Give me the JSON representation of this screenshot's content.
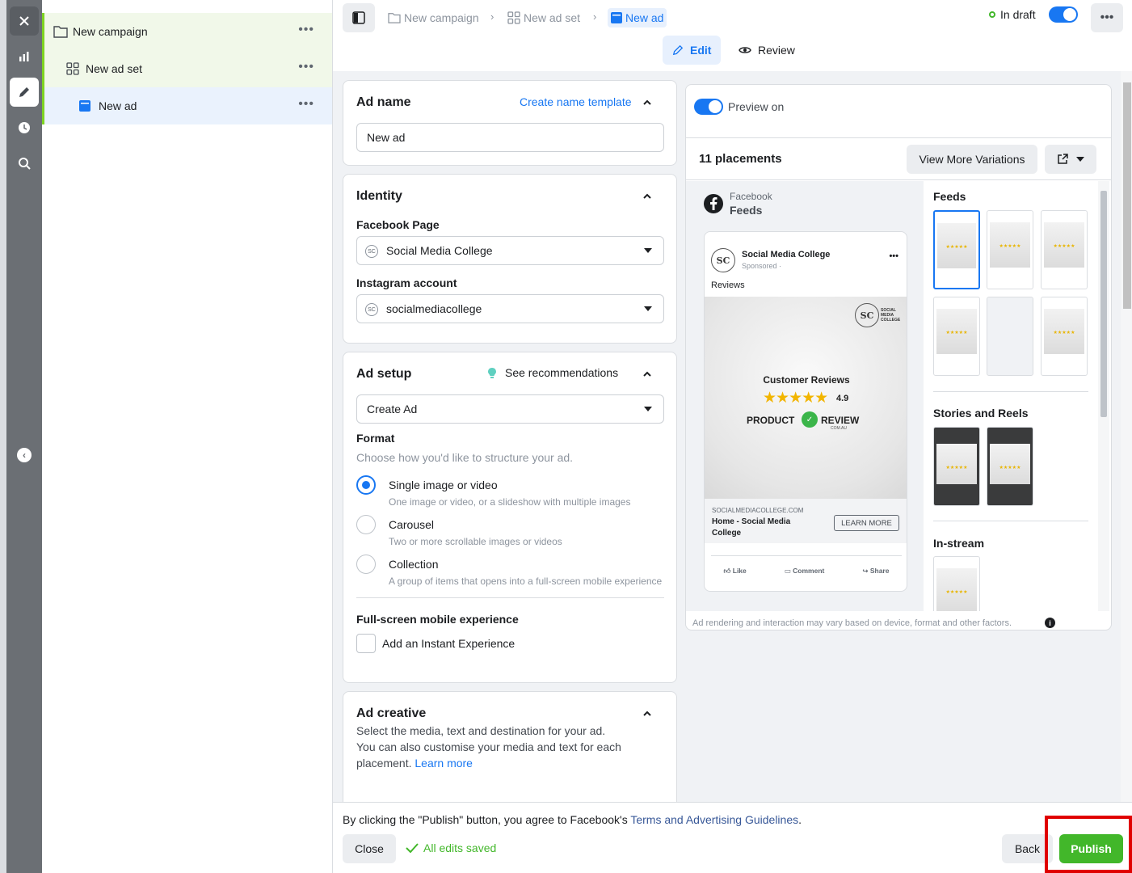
{
  "tree": {
    "campaign": {
      "label": "New campaign"
    },
    "adset": {
      "label": "New ad set"
    },
    "ad": {
      "label": "New ad"
    },
    "more_glyph": "•••"
  },
  "topbar": {
    "breadcrumbs": [
      "New campaign",
      "New ad set",
      "New ad"
    ],
    "status": "In draft",
    "tabs": {
      "edit": "Edit",
      "review": "Review"
    }
  },
  "ad_name": {
    "title": "Ad name",
    "template_link": "Create name template",
    "value": "New ad"
  },
  "identity": {
    "title": "Identity",
    "facebook_page_label": "Facebook Page",
    "facebook_page_value": "Social Media College",
    "instagram_label": "Instagram account",
    "instagram_value": "socialmediacollege"
  },
  "ad_setup": {
    "title": "Ad setup",
    "recommendations": "See recommendations",
    "setup_value": "Create Ad",
    "format_label": "Format",
    "format_desc": "Choose how you'd like to structure your ad.",
    "options": [
      {
        "title": "Single image or video",
        "desc": "One image or video, or a slideshow with multiple images",
        "selected": true
      },
      {
        "title": "Carousel",
        "desc": "Two or more scrollable images or videos",
        "selected": false
      },
      {
        "title": "Collection",
        "desc": "A group of items that opens into a full-screen mobile experience",
        "selected": false
      }
    ],
    "fullscreen_label": "Full-screen mobile experience",
    "instant_experience": "Add an Instant Experience"
  },
  "ad_creative": {
    "title": "Ad creative",
    "desc_line1": "Select the media, text and destination for your ad.",
    "desc_line2": "You can also customise your media and text for each",
    "desc_line3": "placement.",
    "learn_more": "Learn more"
  },
  "preview": {
    "toggle_label": "Preview on",
    "placements_count": "11 placements",
    "variations_button": "View More Variations",
    "platform": "Facebook",
    "placement": "Feeds",
    "post": {
      "page_name": "Social Media College",
      "sponsored": "Sponsored · ",
      "caption": "Reviews",
      "image_title": "Customer Reviews",
      "rating": "4.9",
      "stars": "★★★★★",
      "brand_left": "PRODUCT",
      "brand_right": "REVIEW",
      "brand_sub": "COM.AU",
      "logo_text": "SOCIAL MEDIA COLLEGE",
      "domain": "SOCIALMEDIACOLLEGE.COM",
      "link_title_1": "Home - Social Media",
      "link_title_2": "College",
      "cta": "LEARN MORE",
      "actions": [
        "Like",
        "Comment",
        "Share"
      ]
    },
    "sections": [
      "Feeds",
      "Stories and Reels",
      "In-stream"
    ],
    "disclaimer": "Ad rendering and interaction may vary based on device, format and other factors."
  },
  "footer": {
    "terms_prefix": "By clicking the \"Publish\" button, you agree to Facebook's ",
    "terms_link": "Terms and Advertising Guidelines",
    "terms_suffix": ".",
    "close": "Close",
    "saved": "All edits saved",
    "back": "Back",
    "publish": "Publish"
  },
  "colors": {
    "brand_blue": "#1877f2",
    "publish_green": "#42b72a",
    "highlight_red": "#e00000"
  }
}
